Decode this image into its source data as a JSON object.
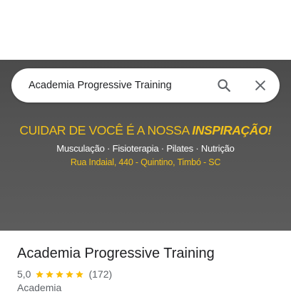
{
  "search": {
    "query": "Academia Progressive Training"
  },
  "banner": {
    "headline_regular": "CUIDAR DE VOCÊ É A NOSSA ",
    "headline_bold": "INSPIRAÇÃO!",
    "services": "Musculação · Fisioterapia · Pilates · Nutrição",
    "address": "Rua Indaial, 440 - Quintino, Timbó - SC"
  },
  "place": {
    "title": "Academia Progressive Training",
    "rating": "5,0",
    "stars": 5,
    "reviews": "(172)",
    "category": "Academia"
  },
  "icons": {
    "search": "search-icon",
    "close": "close-icon",
    "star": "star-icon"
  },
  "colors": {
    "accent_yellow": "#f2c21a",
    "star": "#fbbc04",
    "text_primary": "#202124",
    "text_secondary": "#5f6368"
  }
}
